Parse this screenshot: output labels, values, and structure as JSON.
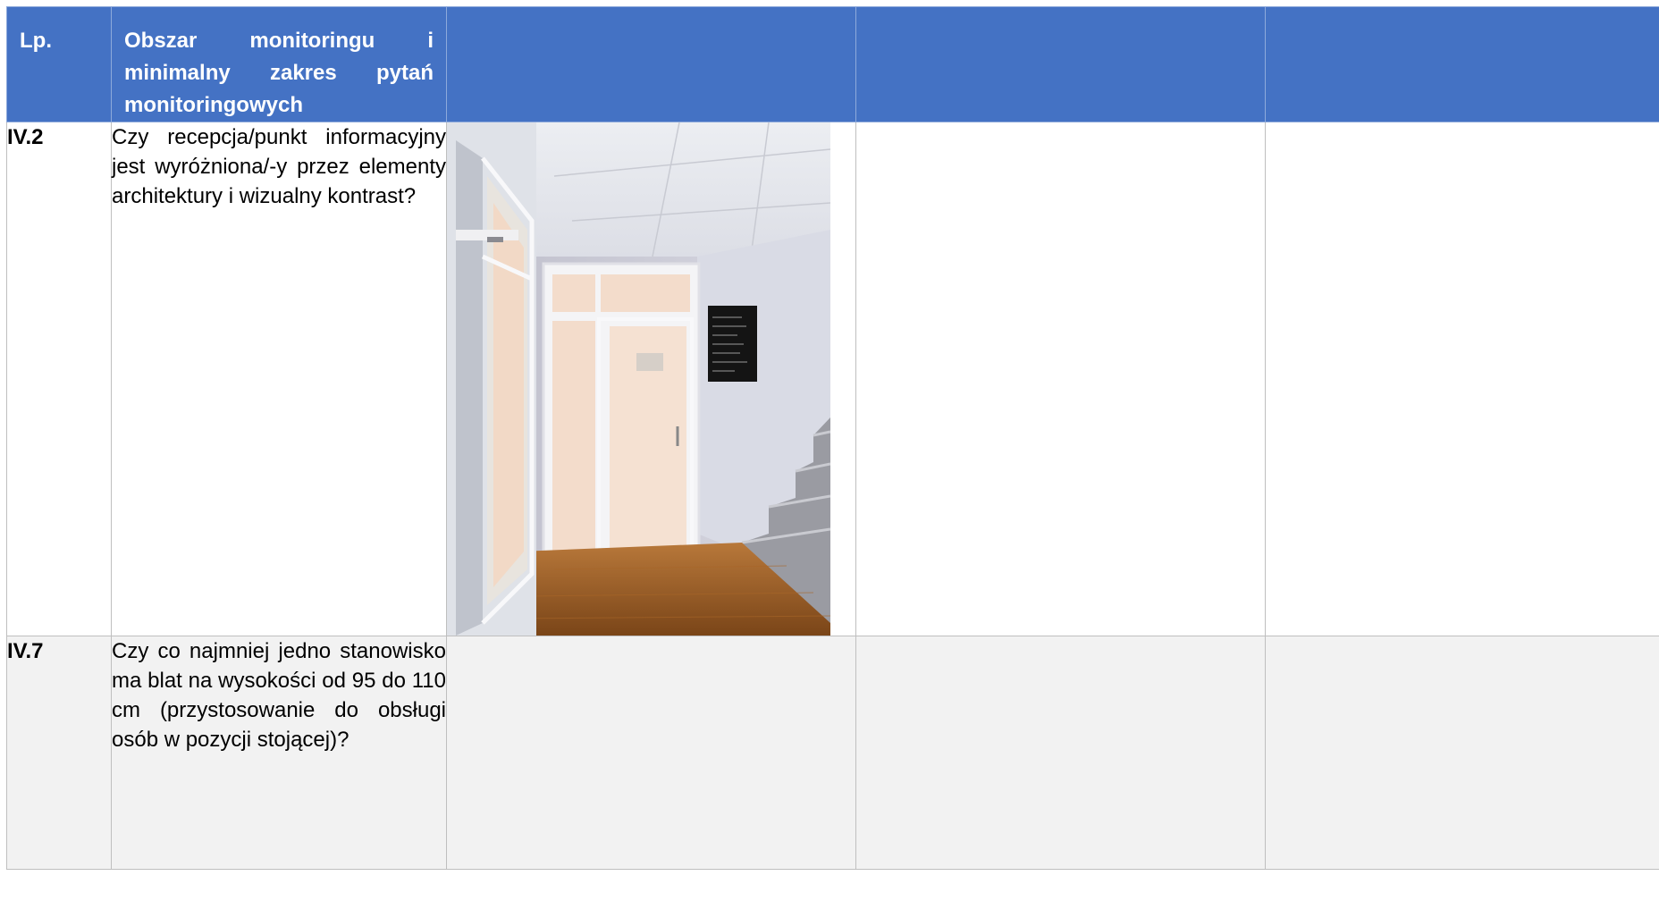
{
  "table": {
    "header": {
      "lp": "Lp.",
      "area": "Obszar monitoringu i minimalny zakres pytań monitoringowych"
    },
    "rows": [
      {
        "lp": "IV.2",
        "question": "Czy recepcja/punkt informacyjny jest wyróżniona/-y przez elementy architektury i wizualny kontrast?"
      },
      {
        "lp": "IV.7",
        "question": "Czy co najmniej jedno stanowisko ma blat na wysokości od 95 do 110 cm (przystosowanie do obsługi osób w pozycji stojącej)?"
      }
    ]
  },
  "colors": {
    "header_bg": "#4472c4",
    "header_text": "#ffffff",
    "alt_row_bg": "#f2f2f2",
    "border": "#bfbfbf"
  }
}
